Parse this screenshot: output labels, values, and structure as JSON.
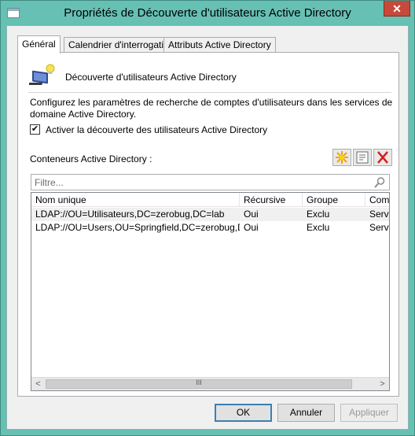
{
  "window": {
    "title": "Propriétés de Découverte d'utilisateurs Active Directory",
    "close_label": "✕"
  },
  "tabs": [
    {
      "label": "Général",
      "active": true
    },
    {
      "label": "Calendrier d'interrogation",
      "active": false
    },
    {
      "label": "Attributs Active Directory",
      "active": false
    }
  ],
  "general": {
    "heading": "Découverte d'utilisateurs Active Directory",
    "description": "Configurez les paramètres de recherche de comptes d'utilisateurs dans les services de domaine Active Directory.",
    "enable_checkbox": {
      "label": "Activer la découverte des utilisateurs Active Directory",
      "checked": true,
      "mark": "✔"
    },
    "containers_label": "Conteneurs Active Directory :",
    "toolbar": {
      "new_icon": "new-star-icon",
      "properties_icon": "properties-icon",
      "delete_icon": "delete-x-icon"
    },
    "filter": {
      "placeholder": "Filtre...",
      "value": "",
      "icon": "search-icon"
    },
    "table": {
      "columns": [
        "Nom unique",
        "Récursive",
        "Groupe",
        "Comp"
      ],
      "rows": [
        [
          "LDAP://OU=Utilisateurs,DC=zerobug,DC=lab",
          "Oui",
          "Exclu",
          "Serv"
        ],
        [
          "LDAP://OU=Users,OU=Springfield,DC=zerobug,DC...",
          "Oui",
          "Exclu",
          "Serv"
        ]
      ],
      "scroll_left": "<",
      "scroll_right": ">",
      "scroll_grip": "III"
    }
  },
  "buttons": {
    "ok": "OK",
    "cancel": "Annuler",
    "apply": "Appliquer"
  },
  "colors": {
    "titlebar": "#67c0b4",
    "close": "#c7493a",
    "delete_icon": "#d62020",
    "new_icon": "#f2a400"
  }
}
